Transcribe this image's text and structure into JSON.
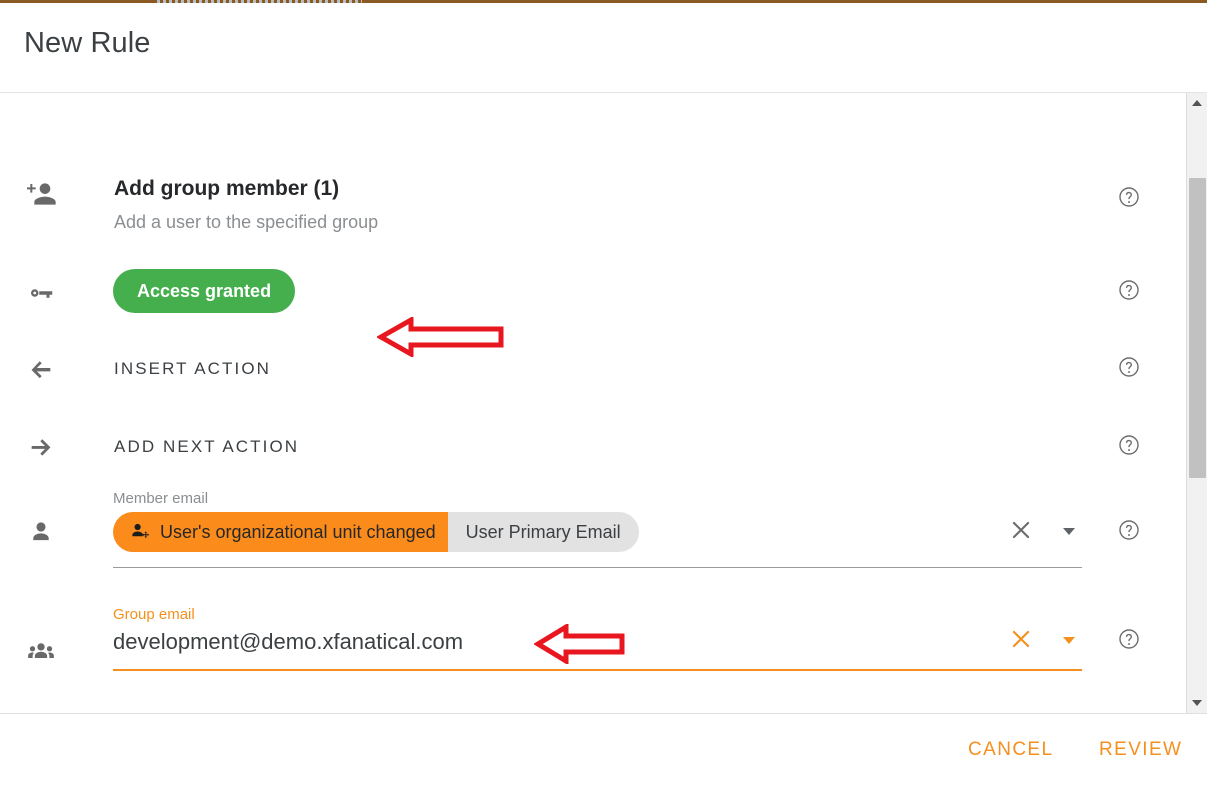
{
  "dialog": {
    "title": "New Rule"
  },
  "theme": {
    "accent": "#f5901e",
    "chip_orange": "#fb8c1c",
    "chip_gray": "#e2e2e2",
    "status_green": "#45af4d",
    "annotation_red": "#e8171f",
    "top_strip": "#8a5a22",
    "text_primary": "#3c4043",
    "text_secondary": "#8b8e91"
  },
  "tabs": {
    "active_indicator_visible": true
  },
  "rows": [
    {
      "icon": "person-add-icon",
      "kind": "action-header",
      "title": "Add group member (1)",
      "subtitle": "Add a user to the specified group",
      "help": "help-icon",
      "annotation": "left-arrow-annotation"
    },
    {
      "icon": "key-icon",
      "kind": "status-pill",
      "pill_label": "Access granted",
      "help": "help-icon"
    },
    {
      "icon": "arrow-left-icon",
      "kind": "text-action",
      "label": "INSERT ACTION",
      "help": "help-icon"
    },
    {
      "icon": "arrow-right-icon",
      "kind": "text-action",
      "label": "ADD NEXT ACTION",
      "help": "help-icon"
    },
    {
      "icon": "person-icon",
      "kind": "chip-field",
      "label": "Member email",
      "focused": false,
      "chip_left_text": "User's organizational unit changed",
      "chip_left_icon": "person-move-icon",
      "chip_right_text": "User Primary Email",
      "clear": "close-icon",
      "dropdown": "chevron-down-icon",
      "help": "help-icon"
    },
    {
      "icon": "people-icon",
      "kind": "text-field",
      "label": "Group email",
      "focused": true,
      "value": "development@demo.xfanatical.com",
      "clear": "close-icon",
      "dropdown": "chevron-down-icon",
      "help": "help-icon",
      "annotation": "left-arrow-annotation"
    }
  ],
  "footer": {
    "cancel_label": "CANCEL",
    "review_label": "REVIEW"
  },
  "scrollbar": {
    "up_arrow": "triangle-up-icon",
    "down_arrow": "triangle-down-icon"
  }
}
